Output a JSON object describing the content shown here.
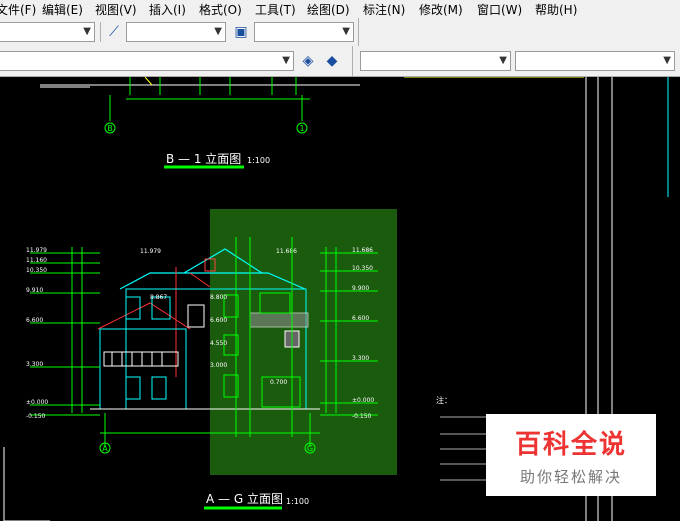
{
  "menu": {
    "items": [
      "文件(F)",
      "编辑(E)",
      "视图(V)",
      "插入(I)",
      "格式(O)",
      "工具(T)",
      "绘图(D)",
      "标注(N)",
      "修改(M)",
      "窗口(W)",
      "帮助(H)"
    ]
  },
  "drawing": {
    "top_title": "B — 1 立面图",
    "top_title_scale": "1:100",
    "bottom_title": "A — G 立面图",
    "bottom_title_scale": "1:100",
    "axis_top_left": "B",
    "axis_top_right": "1",
    "axis_bottom_left": "A",
    "axis_bottom_right": "G",
    "left_elevations": [
      "11.979",
      "11.160",
      "10.350",
      "9.910",
      "6.600",
      "3.300",
      "±0.000",
      "-0.150"
    ],
    "right_elevations": [
      "11.686",
      "10.350",
      "9.900",
      "6.600",
      "3.300",
      "±0.000",
      "-0.150"
    ],
    "inner_labels": [
      "8.800",
      "8.867",
      "6.600",
      "4.550",
      "3.000",
      "0.700",
      "11.979",
      "11.686"
    ],
    "notes_header": "注："
  },
  "watermark": {
    "title": "百科全说",
    "subtitle": "助你轻松解决"
  }
}
